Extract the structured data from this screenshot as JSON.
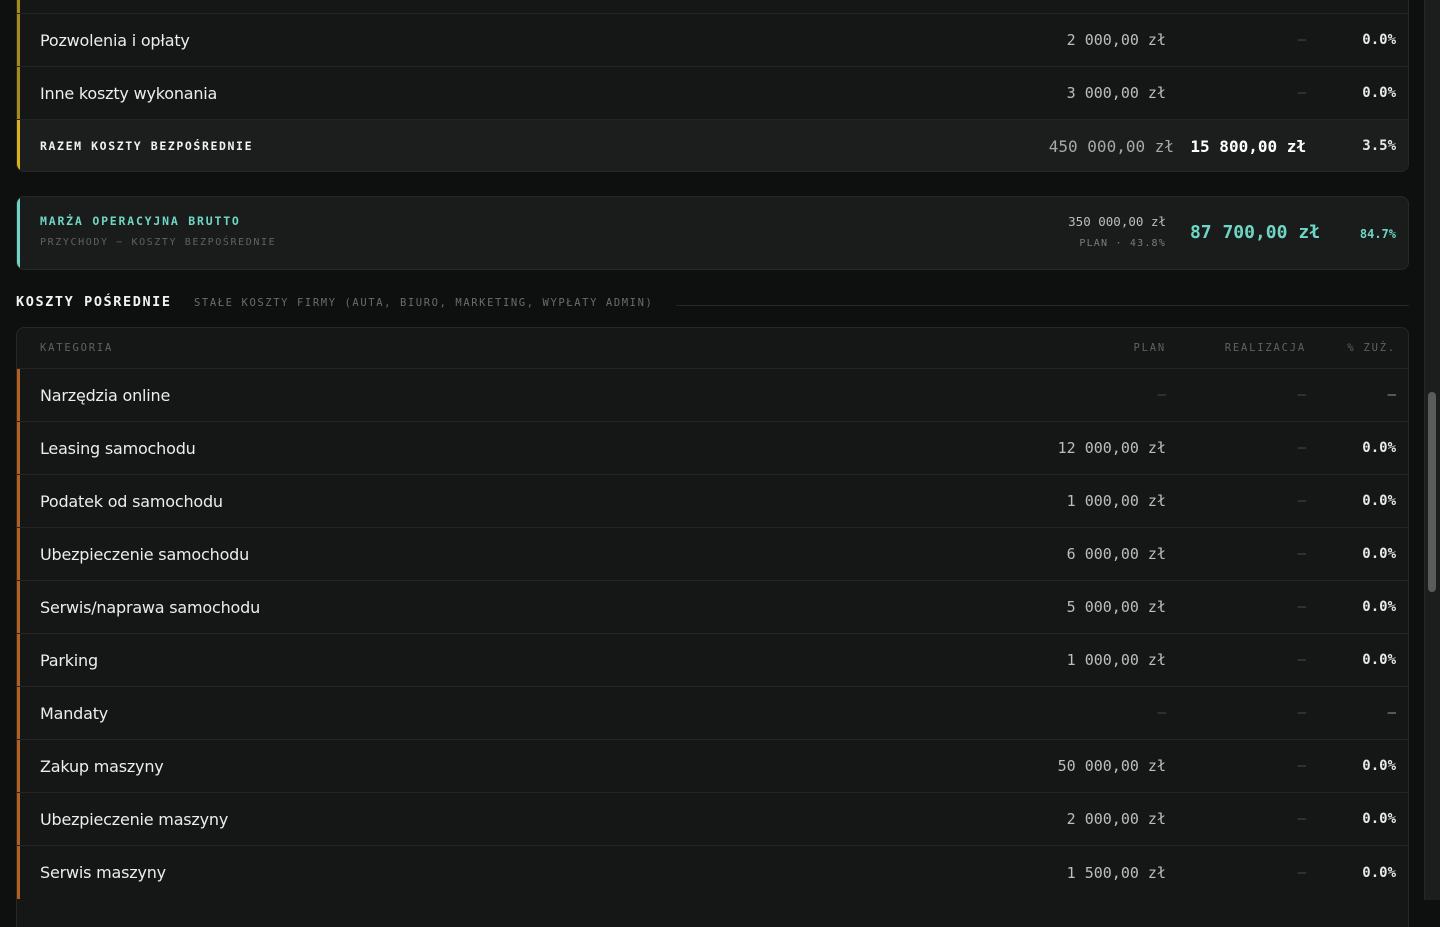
{
  "colors": {
    "accent_direct": "#a68a1c",
    "accent_direct_total": "#d9b21c",
    "accent_margin": "#6fd6c4",
    "accent_indirect": "#b5601e"
  },
  "direct": {
    "rows": [
      {
        "category": "Pozwolenia i opłaty",
        "plan": "2 000,00 zł",
        "real": "—",
        "pct": "0.0%"
      },
      {
        "category": "Inne koszty wykonania",
        "plan": "3 000,00 zł",
        "real": "—",
        "pct": "0.0%"
      }
    ],
    "total": {
      "label": "RAZEM KOSZTY BEZPOŚREDNIE",
      "plan": "450 000,00 zł",
      "real": "15 800,00 zł",
      "pct": "3.5%"
    }
  },
  "margin": {
    "title": "MARŻA OPERACYJNA BRUTTO",
    "subtitle": "PRZYCHODY − KOSZTY BEZPOŚREDNIE",
    "plan": "350 000,00 zł",
    "plan_sub": "PLAN · 43.8%",
    "real": "87 700,00 zł",
    "pct": "84.7%"
  },
  "indirect": {
    "title": "KOSZTY POŚREDNIE",
    "subtitle": "STAŁE KOSZTY FIRMY (AUTA, BIURO, MARKETING, WYPŁATY ADMIN)",
    "headers": {
      "category": "KATEGORIA",
      "plan": "PLAN",
      "real": "REALIZACJA",
      "pct": "% ZUŻ."
    },
    "rows": [
      {
        "category": "Narzędzia online",
        "plan": "—",
        "real": "—",
        "pct": "—"
      },
      {
        "category": "Leasing samochodu",
        "plan": "12 000,00 zł",
        "real": "—",
        "pct": "0.0%"
      },
      {
        "category": "Podatek od samochodu",
        "plan": "1 000,00 zł",
        "real": "—",
        "pct": "0.0%"
      },
      {
        "category": "Ubezpieczenie samochodu",
        "plan": "6 000,00 zł",
        "real": "—",
        "pct": "0.0%"
      },
      {
        "category": "Serwis/naprawa samochodu",
        "plan": "5 000,00 zł",
        "real": "—",
        "pct": "0.0%"
      },
      {
        "category": "Parking",
        "plan": "1 000,00 zł",
        "real": "—",
        "pct": "0.0%"
      },
      {
        "category": "Mandaty",
        "plan": "—",
        "real": "—",
        "pct": "—"
      },
      {
        "category": "Zakup maszyny",
        "plan": "50 000,00 zł",
        "real": "—",
        "pct": "0.0%"
      },
      {
        "category": "Ubezpieczenie maszyny",
        "plan": "2 000,00 zł",
        "real": "—",
        "pct": "0.0%"
      },
      {
        "category": "Serwis maszyny",
        "plan": "1 500,00 zł",
        "real": "—",
        "pct": "0.0%"
      }
    ]
  }
}
